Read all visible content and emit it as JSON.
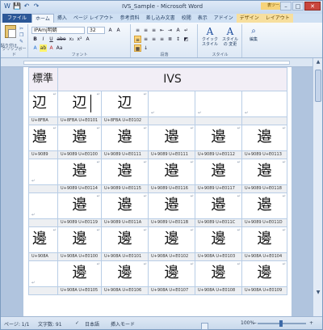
{
  "window": {
    "title": "IVS_Sample - Microsoft Word",
    "context_header": "表ツール",
    "qat": [
      "W",
      "💾",
      "↶",
      "↷"
    ],
    "buttons": [
      "–",
      "□",
      "✕"
    ]
  },
  "tabs": [
    {
      "label": "ファイル",
      "kind": "file"
    },
    {
      "label": "ホーム",
      "kind": "active"
    },
    {
      "label": "挿入",
      "kind": ""
    },
    {
      "label": "ページ レイアウト",
      "kind": ""
    },
    {
      "label": "参考資料",
      "kind": ""
    },
    {
      "label": "差し込み文書",
      "kind": ""
    },
    {
      "label": "校閲",
      "kind": ""
    },
    {
      "label": "表示",
      "kind": ""
    },
    {
      "label": "アドイン",
      "kind": ""
    },
    {
      "label": "デザイン",
      "kind": "ctx"
    },
    {
      "label": "レイアウト",
      "kind": "ctx"
    }
  ],
  "ribbon": {
    "clipboard": {
      "paste_label": "貼り付け",
      "group_label": "クリップボード"
    },
    "font": {
      "name": "IPAmj明朝",
      "size": "32",
      "group_label": "フォント",
      "row1": [
        "A",
        "A",
        "Aa",
        "A"
      ],
      "row2": [
        "B",
        "I",
        "U",
        "abe",
        "x₂",
        "x²",
        "A"
      ],
      "row3": [
        "A",
        "ab",
        "A",
        "Aa"
      ]
    },
    "paragraph": {
      "group_label": "段落",
      "row1": [
        "≡",
        "≡",
        "≡",
        "⇤",
        "⇥",
        "A",
        "↵"
      ],
      "row2": [
        "≡",
        "≡",
        "≡",
        "≡",
        "≣",
        "↕",
        "▦"
      ]
    },
    "styles": {
      "group_label": "スタイル",
      "quick": "クイック\nスタイル",
      "change": "スタイルの\n変更"
    },
    "edit": {
      "label": "編集"
    }
  },
  "table": {
    "header": {
      "left": "標準",
      "right": "IVS"
    },
    "rows": [
      {
        "glyphs": [
          "辺",
          "辺",
          "辺",
          "",
          "",
          ""
        ],
        "codes": [
          "U+8FBA",
          "U+8FBA U+E0101",
          "U+8FBA U+E0102",
          "",
          "",
          ""
        ]
      },
      {
        "glyphs": [
          "邉",
          "邉",
          "邉",
          "邉",
          "邉",
          "邉"
        ],
        "codes": [
          "U+9089",
          "U+9089 U+E0100",
          "U+9089 U+E0111",
          "U+9089 U+E0111",
          "U+9089 U+E0112",
          "U+9089 U+E0113"
        ]
      },
      {
        "glyphs": [
          "",
          "邉",
          "邉",
          "邉",
          "邉",
          "邉"
        ],
        "codes": [
          "",
          "U+9089 U+E0114",
          "U+9089 U+E0115",
          "U+9089 U+E0116",
          "U+9089 U+E0117",
          "U+9089 U+E0118"
        ]
      },
      {
        "glyphs": [
          "",
          "邉",
          "邉",
          "邉",
          "邉",
          "邉"
        ],
        "codes": [
          "",
          "U+9089 U+E0119",
          "U+9089 U+E011A",
          "U+9089 U+E011B",
          "U+9089 U+E011C",
          "U+9089 U+E011D"
        ]
      },
      {
        "glyphs": [
          "邊",
          "邊",
          "邊",
          "邊",
          "邊",
          "邊"
        ],
        "codes": [
          "U+908A",
          "U+908A U+E0100",
          "U+908A U+E0101",
          "U+908A U+E0102",
          "U+908A U+E0103",
          "U+908A U+E0104"
        ]
      },
      {
        "glyphs": [
          "",
          "邊",
          "邊",
          "邊",
          "邊",
          "邊"
        ],
        "codes": [
          "",
          "U+908A U+E0105",
          "U+908A U+E0106",
          "U+908A U+E0107",
          "U+908A U+E0108",
          "U+908A U+E0109"
        ]
      }
    ]
  },
  "status": {
    "page": "ページ: 1/1",
    "words": "文字数: 91",
    "lang": "日本語",
    "mode": "挿入モード",
    "zoom": "100%",
    "zoom_minus": "−",
    "zoom_plus": "+"
  }
}
